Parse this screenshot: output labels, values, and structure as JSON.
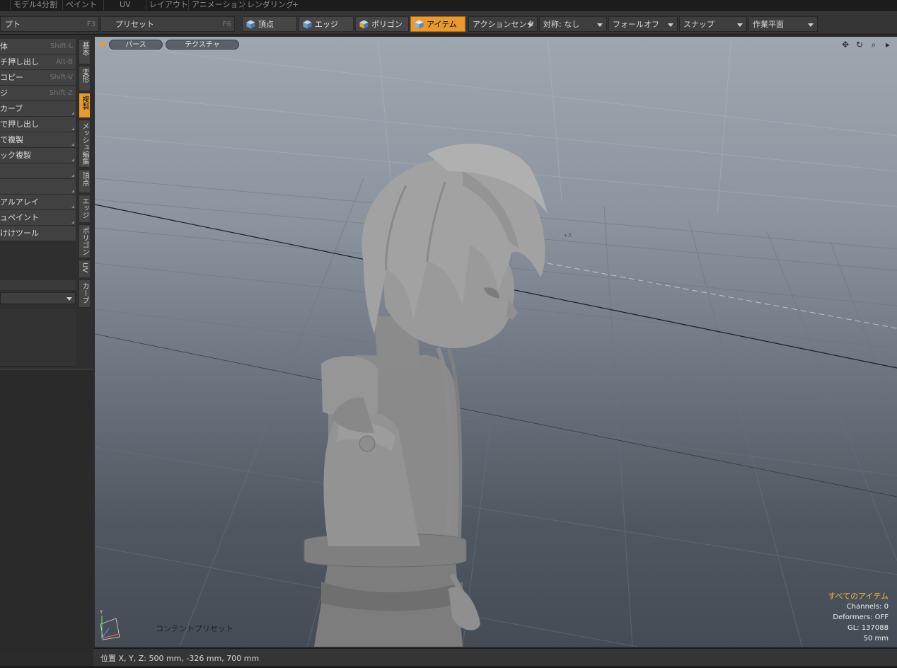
{
  "top_tabs": [
    "モデル4分割",
    "ペイント",
    "UV",
    "レイアウト",
    "アニメーション",
    "レンダリング",
    "+"
  ],
  "toolbar": {
    "script_label": "プト",
    "script_key": "F3",
    "preset_label": "プリセット",
    "preset_key": "F6",
    "modes": [
      {
        "label": "頂点",
        "active": false
      },
      {
        "label": "エッジ",
        "active": false
      },
      {
        "label": "ポリゴン",
        "active": false
      },
      {
        "label": "アイテム",
        "active": true
      }
    ],
    "dropdowns": [
      "アクションセンター",
      "対称: なし",
      "フォールオフ",
      "スナップ",
      "作業平面"
    ]
  },
  "left_panel": {
    "tools": [
      {
        "label": "体",
        "key": "Shift-L"
      },
      {
        "label": "チ押し出し",
        "key": "Alt-B"
      },
      {
        "label": "コピー",
        "key": "Shift-V"
      },
      {
        "label": "ジ",
        "key": "Shift-Z"
      },
      {
        "label": "カーブ",
        "key": ""
      },
      {
        "label": "で押し出し",
        "key": ""
      },
      {
        "label": "で複製",
        "key": ""
      },
      {
        "label": "ック複製",
        "key": ""
      },
      {
        "label": "",
        "key": ""
      },
      {
        "label": "",
        "key": ""
      },
      {
        "label": "アルアレイ",
        "key": ""
      },
      {
        "label": "ュペイント",
        "key": ""
      },
      {
        "label": "けけツール",
        "key": ""
      }
    ],
    "vertical_tabs": [
      {
        "label": "基本",
        "active": false
      },
      {
        "label": "変形",
        "active": false
      },
      {
        "label": "複製",
        "active": true
      },
      {
        "label": "メッシュ編集",
        "active": false
      },
      {
        "label": "頂点",
        "active": false
      },
      {
        "label": "エッジ",
        "active": false
      },
      {
        "label": "ポリゴン",
        "active": false
      },
      {
        "label": "UV",
        "active": false
      },
      {
        "label": "カーブ",
        "active": false
      }
    ]
  },
  "viewport": {
    "view_label": "パース",
    "shade_label": "テクスチャ",
    "content_preset": "コンテントプリセット",
    "axis_label": "+X",
    "info": {
      "title": "すべてのアイテム",
      "channels": "Channels: 0",
      "deformers": "Deformers: OFF",
      "gl": "GL: 137088",
      "size": "50 mm"
    }
  },
  "status": {
    "position": "位置 X, Y, Z:   500 mm, -326 mm, 700 mm"
  },
  "colors": {
    "accent": "#e89a2c",
    "highlight_text": "#f5b73a"
  }
}
